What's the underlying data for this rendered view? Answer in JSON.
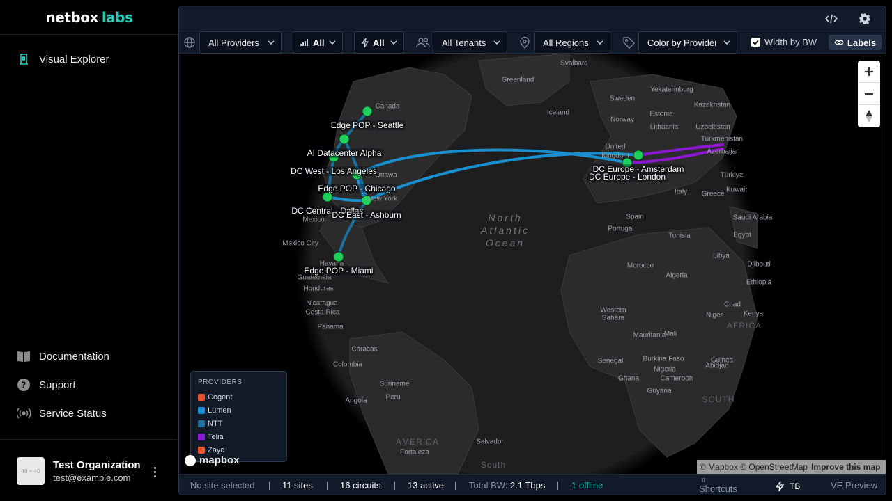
{
  "brand": {
    "part1": "netbox",
    "part2": "labs"
  },
  "sidebar": {
    "primary": [
      {
        "label": "Visual Explorer",
        "icon": "tower-icon"
      }
    ],
    "secondary": [
      {
        "label": "Documentation",
        "icon": "book-icon"
      },
      {
        "label": "Support",
        "icon": "help-icon"
      },
      {
        "label": "Service Status",
        "icon": "broadcast-icon"
      }
    ],
    "org": {
      "name": "Test Organization",
      "email": "test@example.com",
      "avatar_placeholder": "40 × 40"
    }
  },
  "filters": {
    "provider": "All Providers",
    "signal": "All",
    "power": "All",
    "tenant": "All Tenants",
    "region": "All Regions",
    "color_by": "Color by Provider",
    "width_by_bw": "Width by BW",
    "labels": "Labels"
  },
  "map": {
    "ocean_label": "North Atlantic Ocean",
    "ocean_lines": [
      "North",
      "Atlantic",
      "Ocean"
    ],
    "geo_labels": [
      "Svalbard",
      "Greenland",
      "Canada",
      "Iceland",
      "Yekaterinburg",
      "Sweden",
      "Norway",
      "Estonia",
      "Kazakhstan",
      "Lithuania",
      "Uzbekistan",
      "Turkmenistan",
      "Azerbaijan",
      "Türkiye",
      "United",
      "Kingdom",
      "Ottawa",
      "New York",
      "Italy",
      "Greece",
      "Kuwait",
      "Spain",
      "Portugal",
      "Saudi Arabia",
      "Tunisia",
      "Egypt",
      "Mexico",
      "Mexico City",
      "Libya",
      "Djibouti",
      "Havana",
      "Guatemala",
      "Honduras",
      "Morocco",
      "Algeria",
      "Ethiopia",
      "Nicaragua",
      "Costa Rica",
      "Western",
      "Sahara",
      "Chad",
      "Kenya",
      "Panama",
      "Mauritania",
      "Mali",
      "Niger",
      "AFRICA",
      "Caracas",
      "Colombia",
      "Senegal",
      "Burkina Faso",
      "Nigeria",
      "Guinea",
      "Ghana",
      "Cameroon",
      "Abidjan",
      "Guyana",
      "Suriname",
      "Peru",
      "Angola",
      "SOUTH",
      "AMERICA",
      "Fortaleza",
      "Salvador",
      "South"
    ],
    "sites": [
      {
        "name": "Edge POP - Seattle"
      },
      {
        "name": "AI Datacenter Alpha"
      },
      {
        "name": "DC West - Los Angeles"
      },
      {
        "name": "Edge POP - Chicago"
      },
      {
        "name": "DC Central - Dallas"
      },
      {
        "name": "DC East - Ashburn"
      },
      {
        "name": "Edge POP - Miami"
      },
      {
        "name": "DC Europe - Amsterdam"
      },
      {
        "name": "DC Europe - London"
      }
    ],
    "legend": {
      "title": "PROVIDERS",
      "items": [
        {
          "name": "Cogent",
          "color": "#e8532c"
        },
        {
          "name": "Lumen",
          "color": "#1a8fd0"
        },
        {
          "name": "NTT",
          "color": "#1a6f9c"
        },
        {
          "name": "Telia",
          "color": "#8a18d0"
        },
        {
          "name": "Zayo",
          "color": "#e8532c"
        }
      ]
    },
    "site_color": "#1fd15a",
    "mapbox_logo": "mapbox",
    "attribution": {
      "text": "© Mapbox © OpenStreetMap",
      "link": "Improve this map"
    }
  },
  "status": {
    "selection": "No site selected",
    "sites": "11 sites",
    "circuits": "16 circuits",
    "active": "13 active",
    "total_bw_label": "Total BW:",
    "total_bw_value": "2.1 Tbps",
    "offline": "1 offline",
    "shortcuts": "Shortcuts",
    "tb": "TB",
    "preview": "VE Preview"
  }
}
